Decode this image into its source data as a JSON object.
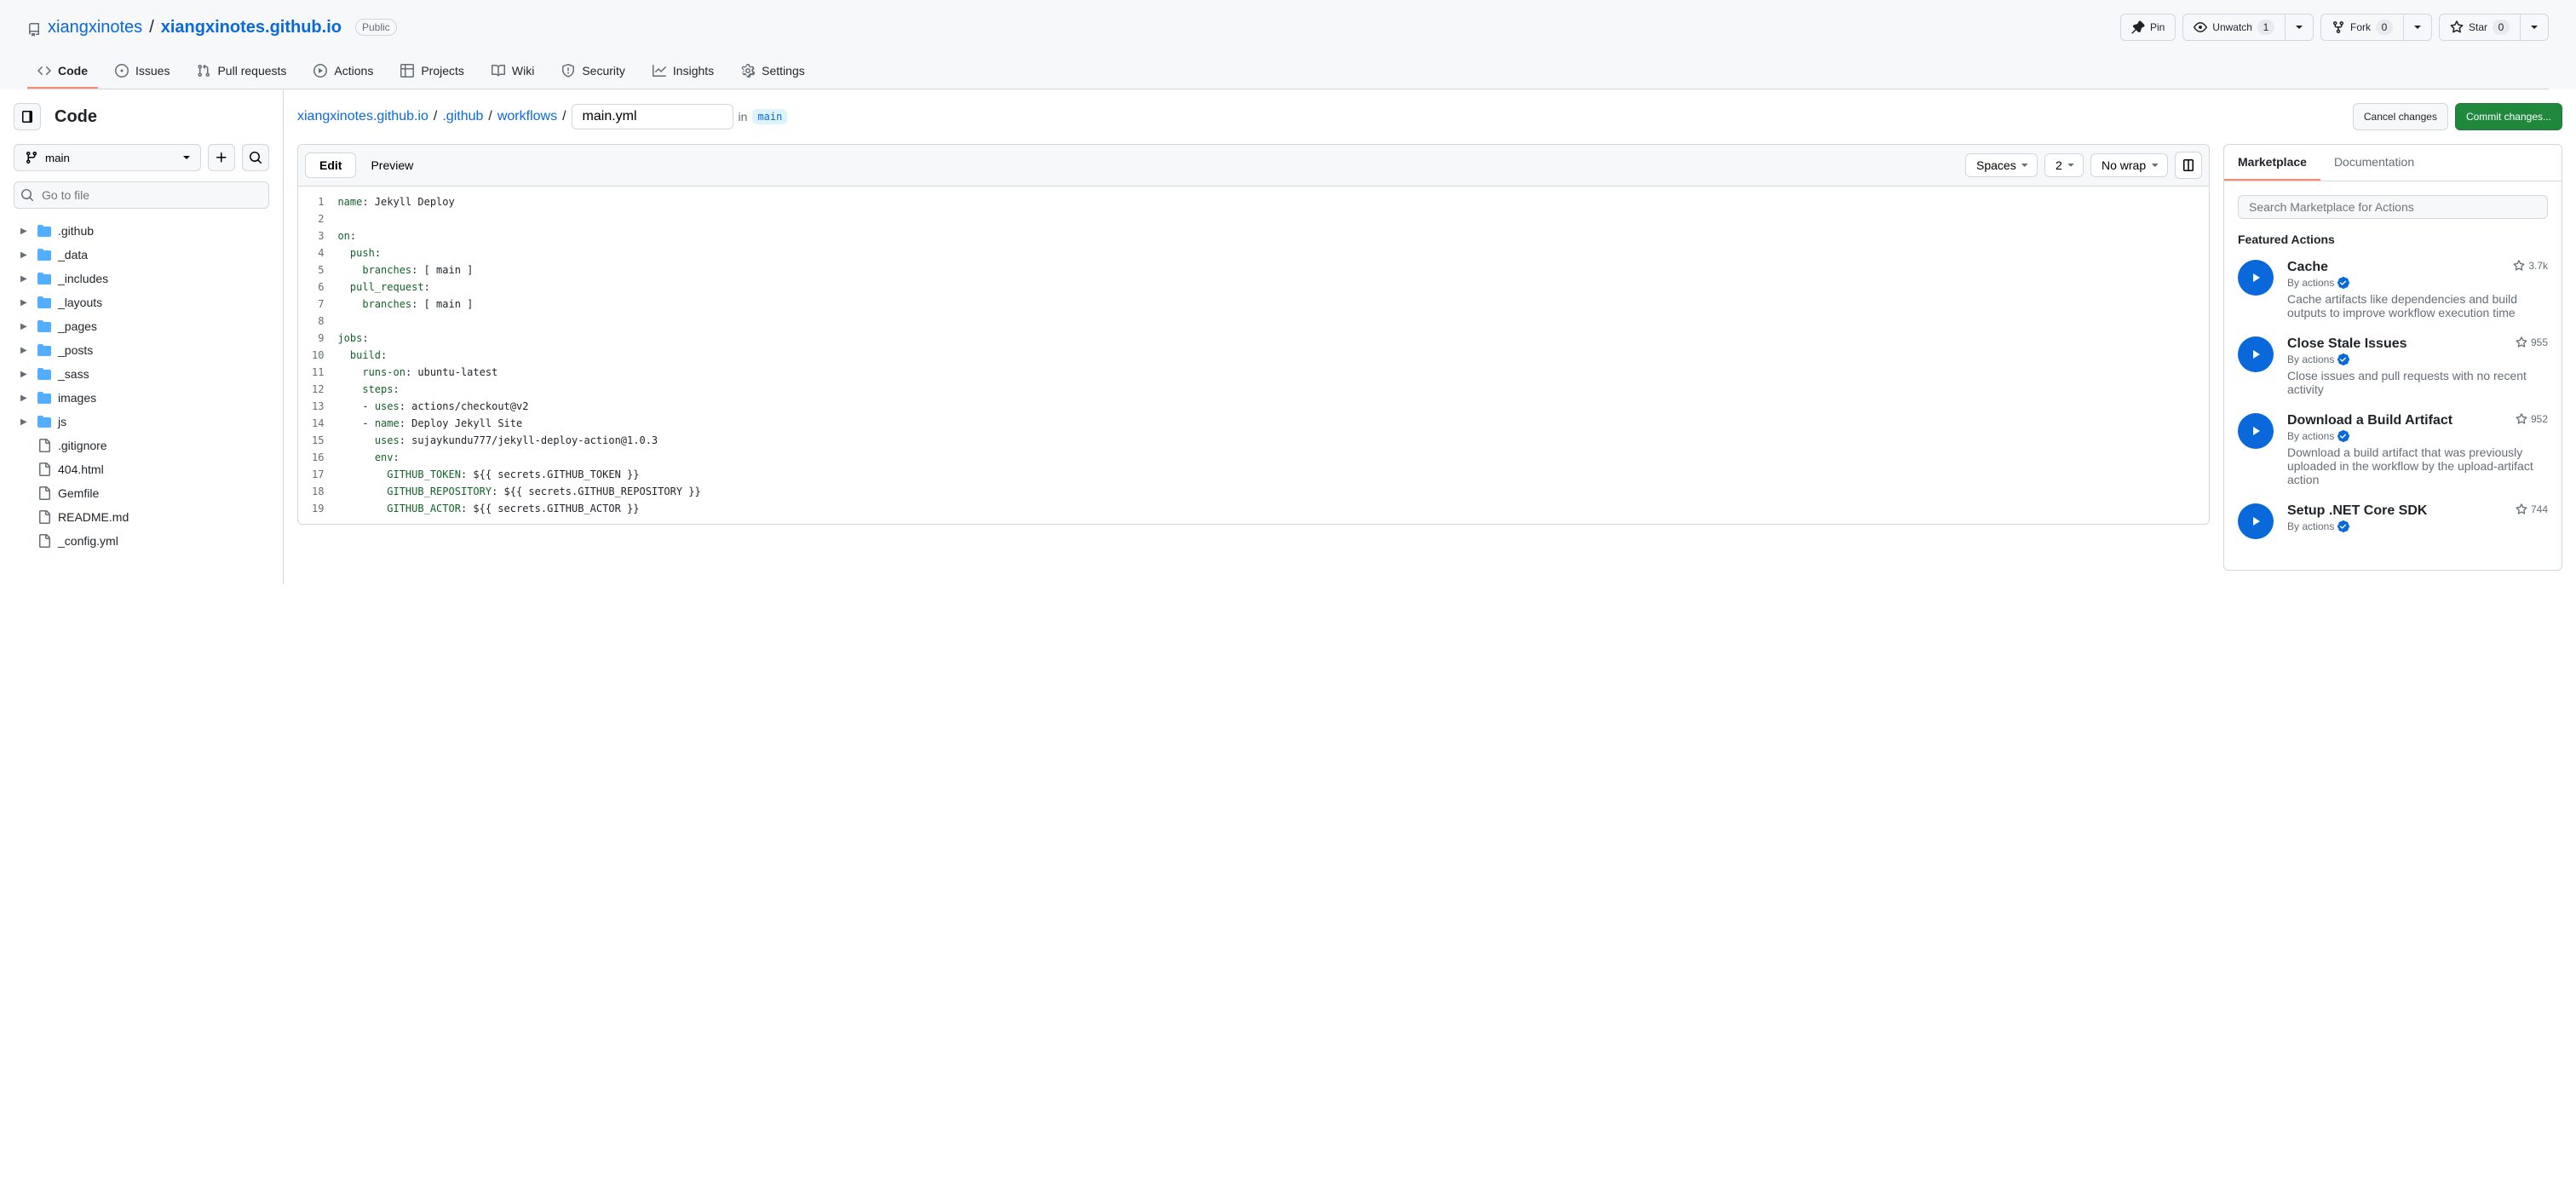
{
  "header": {
    "owner": "xiangxinotes",
    "repo": "xiangxinotes.github.io",
    "visibility": "Public",
    "buttons": {
      "pin": "Pin",
      "unwatch": "Unwatch",
      "unwatch_count": "1",
      "fork": "Fork",
      "fork_count": "0",
      "star": "Star",
      "star_count": "0"
    }
  },
  "nav": {
    "code": "Code",
    "issues": "Issues",
    "pull_requests": "Pull requests",
    "actions": "Actions",
    "projects": "Projects",
    "wiki": "Wiki",
    "security": "Security",
    "insights": "Insights",
    "settings": "Settings"
  },
  "sidebar": {
    "title": "Code",
    "branch": "main",
    "search_placeholder": "Go to file",
    "tree": [
      {
        "type": "folder",
        "name": ".github"
      },
      {
        "type": "folder",
        "name": "_data"
      },
      {
        "type": "folder",
        "name": "_includes"
      },
      {
        "type": "folder",
        "name": "_layouts"
      },
      {
        "type": "folder",
        "name": "_pages"
      },
      {
        "type": "folder",
        "name": "_posts"
      },
      {
        "type": "folder",
        "name": "_sass"
      },
      {
        "type": "folder",
        "name": "images"
      },
      {
        "type": "folder",
        "name": "js"
      },
      {
        "type": "file",
        "name": ".gitignore"
      },
      {
        "type": "file",
        "name": "404.html"
      },
      {
        "type": "file",
        "name": "Gemfile"
      },
      {
        "type": "file",
        "name": "README.md"
      },
      {
        "type": "file",
        "name": "_config.yml"
      }
    ]
  },
  "breadcrumb": {
    "repo": "xiangxinotes.github.io",
    "path1": ".github",
    "path2": "workflows",
    "filename": "main.yml",
    "in_label": "in",
    "branch": "main"
  },
  "actions": {
    "cancel": "Cancel changes",
    "commit": "Commit changes..."
  },
  "editor_toolbar": {
    "edit": "Edit",
    "preview": "Preview",
    "indent_mode": "Spaces",
    "indent_size": "2",
    "wrap": "No wrap"
  },
  "code_lines": [
    [
      {
        "k": "name",
        "p": ": Jekyll Deploy"
      }
    ],
    [],
    [
      {
        "k": "on",
        "p": ":"
      }
    ],
    [
      {
        "i": 1,
        "k": "push",
        "p": ":"
      }
    ],
    [
      {
        "i": 2,
        "k": "branches",
        "p": ": [ main ]"
      }
    ],
    [
      {
        "i": 1,
        "k": "pull_request",
        "p": ":"
      }
    ],
    [
      {
        "i": 2,
        "k": "branches",
        "p": ": [ main ]"
      }
    ],
    [],
    [
      {
        "k": "jobs",
        "p": ":"
      }
    ],
    [
      {
        "i": 1,
        "k": "build",
        "p": ":"
      }
    ],
    [
      {
        "i": 2,
        "k": "runs-on",
        "p": ": ubuntu-latest"
      }
    ],
    [
      {
        "i": 2,
        "k": "steps",
        "p": ":"
      }
    ],
    [
      {
        "i": 2,
        "p": "- ",
        "k": "uses",
        "p2": ": actions/checkout@v2"
      }
    ],
    [
      {
        "i": 2,
        "p": "- ",
        "k": "name",
        "p2": ": Deploy Jekyll Site"
      }
    ],
    [
      {
        "i": 3,
        "k": "uses",
        "p": ": sujaykundu777/jekyll-deploy-action@1.0.3"
      }
    ],
    [
      {
        "i": 3,
        "k": "env",
        "p": ":"
      }
    ],
    [
      {
        "i": 4,
        "k": "GITHUB_TOKEN",
        "p": ": ${{ secrets.GITHUB_TOKEN }}"
      }
    ],
    [
      {
        "i": 4,
        "k": "GITHUB_REPOSITORY",
        "p": ": ${{ secrets.GITHUB_REPOSITORY }}"
      }
    ],
    [
      {
        "i": 4,
        "k": "GITHUB_ACTOR",
        "p": ": ${{ secrets.GITHUB_ACTOR }}"
      }
    ]
  ],
  "right_panel": {
    "tabs": {
      "marketplace": "Marketplace",
      "documentation": "Documentation"
    },
    "search_placeholder": "Search Marketplace for Actions",
    "featured_title": "Featured Actions",
    "by_prefix": "By ",
    "actions": [
      {
        "title": "Cache",
        "by": "actions",
        "stars": "3.7k",
        "desc": "Cache artifacts like dependencies and build outputs to improve workflow execution time"
      },
      {
        "title": "Close Stale Issues",
        "by": "actions",
        "stars": "955",
        "desc": "Close issues and pull requests with no recent activity"
      },
      {
        "title": "Download a Build Artifact",
        "by": "actions",
        "stars": "952",
        "desc": "Download a build artifact that was previously uploaded in the workflow by the upload-artifact action"
      },
      {
        "title": "Setup .NET Core SDK",
        "by": "actions",
        "stars": "744",
        "desc": ""
      }
    ]
  }
}
